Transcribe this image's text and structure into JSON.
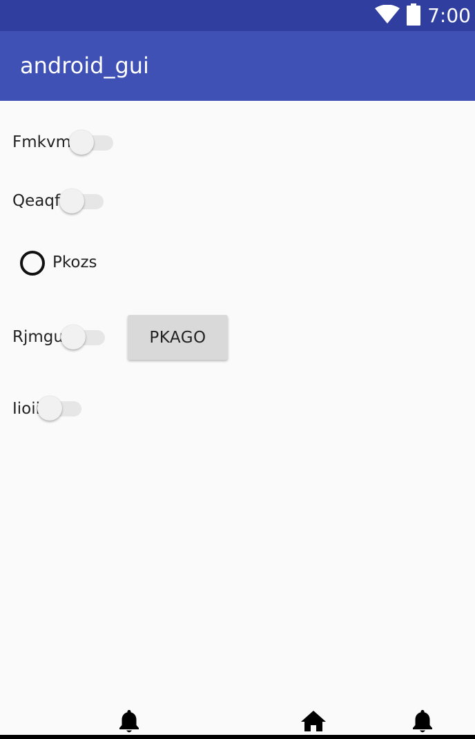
{
  "status_bar": {
    "time": "7:00",
    "icons": [
      "wifi-icon",
      "battery-icon"
    ],
    "color": "#303F9F"
  },
  "app_bar": {
    "title": "android_gui",
    "color": "#3F51B5"
  },
  "controls": {
    "switch_1": {
      "label": "Fmkvm",
      "checked": false
    },
    "switch_2": {
      "label": "Qeaqf",
      "checked": false
    },
    "radio_1": {
      "label": "Pkozs",
      "checked": false
    },
    "switch_3": {
      "label": "Rjmgu",
      "checked": false
    },
    "button_1": {
      "label": "PKAGO"
    },
    "switch_4": {
      "label": "Iioii",
      "checked": false
    }
  },
  "bottom_nav": {
    "icons": [
      "bell-icon",
      "home-icon",
      "bell-icon"
    ]
  }
}
